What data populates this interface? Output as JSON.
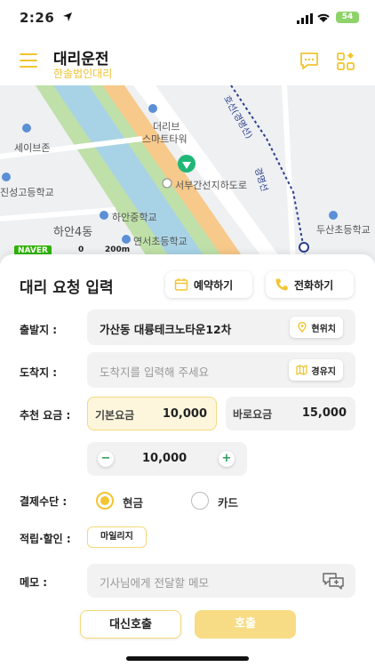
{
  "status": {
    "time": "2:26",
    "battery": "54"
  },
  "header": {
    "title": "대리운전",
    "subtitle": "한솔법인대리"
  },
  "map": {
    "labels": [
      "세이브존",
      "진성고등학교",
      "하안4동",
      "더리브",
      "스마트타워",
      "서부간선지하도로",
      "하안중학교",
      "연서초등학교",
      "두산초등학교",
      "호선(경명선)",
      "경명선"
    ],
    "logo": "NAVER",
    "scale": [
      "0",
      "200m"
    ]
  },
  "form": {
    "title": "대리 요청 입력",
    "reserve_label": "예약하기",
    "call_label": "전화하기",
    "origin": {
      "label": "출발지 :",
      "value": "가산동 대륭테크노타운12차",
      "button": "현위치"
    },
    "destination": {
      "label": "도착지 :",
      "placeholder": "도착지를 입력해 주세요",
      "button": "경유지"
    },
    "fare": {
      "label": "추천 요금 :",
      "basic_label": "기본요금",
      "basic_value": "10,000",
      "instant_label": "바로요금",
      "instant_value": "15,000"
    },
    "stepper": {
      "value": "10,000",
      "minus": "−",
      "plus": "+"
    },
    "payment": {
      "label": "결제수단 :",
      "options": [
        "현금",
        "카드"
      ],
      "selected": "현금"
    },
    "points": {
      "label": "적립·할인 :",
      "button": "마일리지"
    },
    "memo": {
      "label": "메모 :",
      "placeholder": "기사님에게 전달할 메모"
    },
    "proxy_call": "대신호출",
    "call": "호출"
  },
  "colors": {
    "accent": "#f2c531",
    "accent_light": "#fbe9a8",
    "selected_fare_bg": "#fdf6dd"
  }
}
